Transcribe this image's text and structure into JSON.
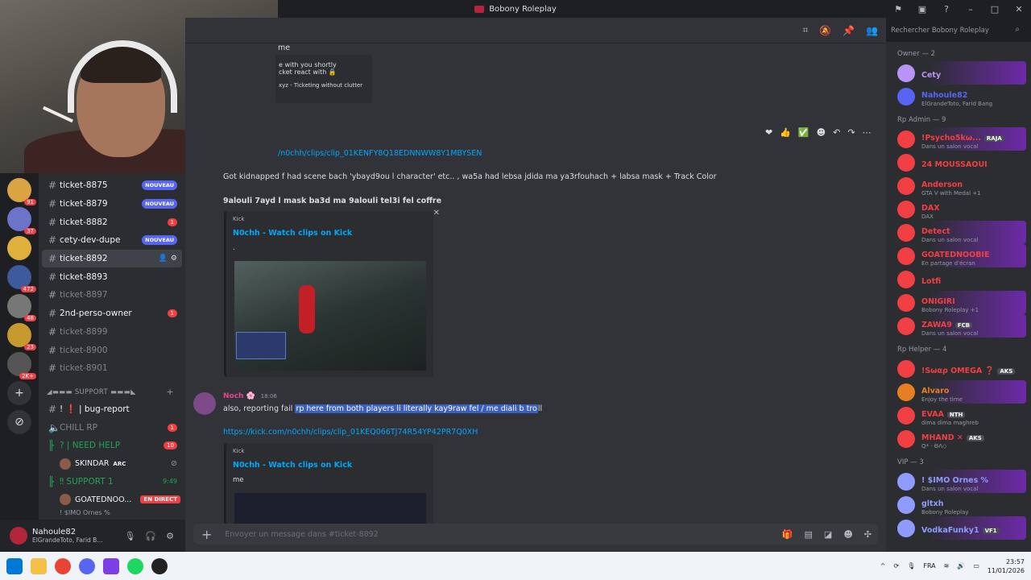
{
  "window": {
    "title": "Bobony Roleplay"
  },
  "user_panel": {
    "name": "Nahoule82",
    "status": "ElGrandeToto, Farid B..."
  },
  "guild_badges": [
    "91",
    "37",
    "472",
    "48",
    "23",
    "2K+"
  ],
  "channels": [
    {
      "name": "ticket-8875",
      "badge": "NOUVEAU",
      "type": "new",
      "muted": false
    },
    {
      "name": "ticket-8879",
      "badge": "NOUVEAU",
      "type": "new",
      "muted": false
    },
    {
      "name": "ticket-8882",
      "badge": "1",
      "type": "count",
      "muted": false
    },
    {
      "name": "cety-dev-dupe",
      "badge": "NOUVEAU",
      "type": "new",
      "muted": false
    },
    {
      "name": "ticket-8892",
      "badge": "",
      "type": "selected",
      "muted": false
    },
    {
      "name": "ticket-8893",
      "badge": "",
      "type": "",
      "muted": false
    },
    {
      "name": "ticket-8897",
      "badge": "",
      "type": "",
      "muted": true
    },
    {
      "name": "2nd-perso-owner",
      "badge": "1",
      "type": "count",
      "muted": false
    },
    {
      "name": "ticket-8899",
      "badge": "",
      "type": "",
      "muted": true
    },
    {
      "name": "ticket-8900",
      "badge": "",
      "type": "",
      "muted": true
    },
    {
      "name": "ticket-8901",
      "badge": "",
      "type": "",
      "muted": true
    }
  ],
  "support_category": "◢▬▬▬ SUPPORT ▬▬▬◣",
  "support_channels": {
    "bug_report": "! ❗ | bug-report",
    "chill": "CHILL RP",
    "chill_badge": "1",
    "need_help": "? | NEED HELP",
    "need_help_badge": "10",
    "skindar": "SKINDAR",
    "skindar_tag": "ARC",
    "support1": "‼ SUPPORT 1",
    "support1_time": "9:49",
    "goated": "GOATEDNOO...",
    "live": "EN DIRECT",
    "simo": "! $IMO Ornes %"
  },
  "chat": {
    "bot_card": {
      "line1": "e with you shortly",
      "line2": "cket react with 🔒",
      "line3": "xyz - Ticketing without clutter"
    },
    "top_line": "me",
    "link1": "/n0chh/clips/clip_01KENFY8Q18EDNNWW8Y1MBYSEN",
    "msg1": "Got kidnapped f had scene bach 'ybayd9ou l character' etc.. , wa5a had lebsa jdida ma ya3rfouhach + labsa mask + Track Color",
    "msg2": "9alouli 7ayd l mask ba3d ma 9alouli tel3i fel coffre",
    "embed1": {
      "provider": "Kick",
      "title": "N0chh - Watch clips on Kick",
      "desc": "."
    },
    "author": "Noch 🌸",
    "time": "18:06",
    "msg3_a": "also, reporting fail ",
    "msg3_b": "rp here from both players li literally kay9raw fel / me diali b tro",
    "msg3_c": "ll",
    "link2": "https://kick.com/n0chh/clips/clip_01KEQ066TJ74R54YP42PR7Q0XH",
    "embed2": {
      "provider": "Kick",
      "title": "N0chh - Watch clips on Kick",
      "desc": "me"
    },
    "composer_placeholder": "Envoyer un message dans #ticket-8892"
  },
  "search": {
    "placeholder": "Rechercher Bobony Roleplay"
  },
  "members": {
    "owner_cat": "Owner — 2",
    "owners": [
      {
        "name": "Cety",
        "status": "",
        "color": "#b794f6",
        "grad": true
      },
      {
        "name": "Nahoule82",
        "status": "ElGrandeToto, Farid Bang",
        "color": "#5865f2",
        "grad": false
      }
    ],
    "admin_cat": "Rp Admin — 9",
    "admins": [
      {
        "name": "!Psycho5kω...",
        "status": "Dans un salon vocal",
        "tag": "RAJA",
        "color": "#f23f43",
        "grad": true
      },
      {
        "name": "24 MOUSSAOUI",
        "status": "",
        "tag": "",
        "color": "#f23f43",
        "grad": false
      },
      {
        "name": "Anderson",
        "status": "GTA V with Medal +1",
        "tag": "",
        "color": "#f23f43",
        "grad": false
      },
      {
        "name": "DAX",
        "status": "DAX",
        "tag": "",
        "color": "#f23f43",
        "grad": false
      },
      {
        "name": "Detect",
        "status": "Dans un salon vocal",
        "tag": "",
        "color": "#f23f43",
        "grad": true
      },
      {
        "name": "GOATEDNOOBIE",
        "status": "En partage d'écran",
        "tag": "",
        "color": "#f23f43",
        "grad": true
      },
      {
        "name": "Lotfi",
        "status": "",
        "tag": "",
        "color": "#f23f43",
        "grad": false
      },
      {
        "name": "ONIGIRI",
        "status": "Bobony Roleplay +1",
        "tag": "",
        "color": "#f23f43",
        "grad": true
      },
      {
        "name": "ZAWA9",
        "status": "Dans un salon vocal",
        "tag": "FCB",
        "color": "#f23f43",
        "grad": true
      }
    ],
    "helper_cat": "Rp Helper — 4",
    "helpers": [
      {
        "name": "!Sωαρ OMEGA ❓",
        "status": "",
        "tag": "AKS",
        "color": "#f23f43",
        "grad": false
      },
      {
        "name": "Alvaro",
        "status": "Enjoy the time",
        "tag": "",
        "color": "#e67e22",
        "grad": true
      },
      {
        "name": "EVAA",
        "status": "dima dima maghreb",
        "tag": "NTH",
        "color": "#f23f43",
        "grad": false
      },
      {
        "name": "MHAND ✕",
        "status": "Q* · ΘΛ◇",
        "tag": "AKS",
        "color": "#f23f43",
        "grad": false
      }
    ],
    "vip_cat": "VIP — 3",
    "vips": [
      {
        "name": "! $IMO Ornes %",
        "status": "Dans un salon vocal",
        "tag": "",
        "color": "#8e9cff",
        "grad": true
      },
      {
        "name": "gltxh",
        "status": "Bobony Roleplay",
        "tag": "",
        "color": "#8e9cff",
        "grad": false
      },
      {
        "name": "VodkaFunky1",
        "status": "",
        "tag": "VF1",
        "color": "#8e9cff",
        "grad": true
      }
    ]
  },
  "taskbar": {
    "lang": "FRA",
    "time": "23:57",
    "date": "11/01/2026"
  }
}
